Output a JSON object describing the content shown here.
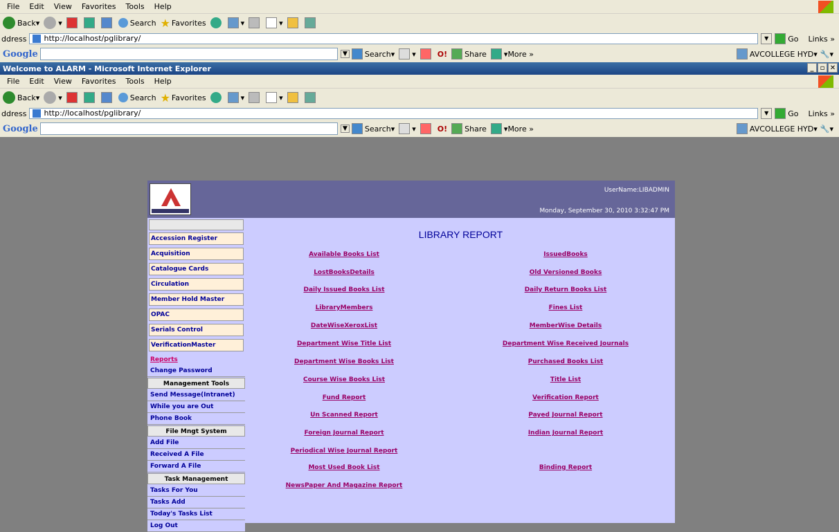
{
  "browser_outer": {
    "menu": [
      "File",
      "Edit",
      "View",
      "Favorites",
      "Tools",
      "Help"
    ],
    "toolbar": {
      "back": "Back",
      "search": "Search",
      "favorites": "Favorites"
    },
    "address_label": "ddress",
    "address": "http://localhost/pglibrary/",
    "go": "Go",
    "links": "Links »",
    "google": {
      "logo": "Google",
      "search": "Search",
      "share": "Share",
      "more": "More »",
      "account": "AVCOLLEGE HYD"
    }
  },
  "window": {
    "title": "Welcome to ALARM - Microsoft Internet Explorer"
  },
  "browser_inner": {
    "menu": [
      "File",
      "Edit",
      "View",
      "Favorites",
      "Tools",
      "Help"
    ],
    "toolbar": {
      "back": "Back",
      "search": "Search",
      "favorites": "Favorites"
    },
    "address_label": "ddress",
    "address": "http://localhost/pglibrary/",
    "go": "Go",
    "links": "Links »",
    "google": {
      "logo": "Google",
      "search": "Search",
      "share": "Share",
      "more": "More »",
      "account": "AVCOLLEGE HYD"
    }
  },
  "header": {
    "username": "UserName:LIBADMIN",
    "datetime": "Monday, September 30, 2010 3:32:47 PM"
  },
  "sidebar": {
    "items": [
      "Accession Register",
      "Acquisition",
      "Catalogue Cards",
      "Circulation",
      "Member Hold Master",
      "OPAC",
      "Serials Control",
      "VerificationMaster"
    ],
    "selected": "Reports",
    "plain1": "Change Password",
    "head1": "Management Tools",
    "mgmt": [
      "Send Message(Intranet)",
      "While you are Out",
      "Phone Book"
    ],
    "head2": "File Mngt System",
    "file": [
      "Add File",
      "Received A File",
      "Forward A File"
    ],
    "head3": "Task Management",
    "task": [
      "Tasks For You",
      "Tasks Add",
      "Today's Tasks List",
      "Log Out"
    ]
  },
  "content": {
    "title": "LIBRARY REPORT",
    "left_links": [
      "Available Books List",
      "LostBooksDetails",
      "Daily Issued Books List",
      "LibraryMembers",
      "DateWiseXeroxList",
      "Department Wise Title List",
      "Department Wise Books List",
      "Course Wise Books List",
      "Fund Report",
      "Un Scanned Report",
      "Foreign Journal Report",
      "Periodical Wise Journal Report",
      "Most Used Book List",
      "NewsPaper And Magazine Report"
    ],
    "right_links": [
      "IssuedBooks",
      "Old Versioned Books",
      "Daily Return Books List",
      "Fines List",
      "MemberWise Details",
      "Department Wise Received Journals",
      "Purchased Books List",
      "Title List",
      "Verification Report",
      "Payed Journal Report",
      "Indian Journal Report",
      "Binding Report"
    ]
  }
}
